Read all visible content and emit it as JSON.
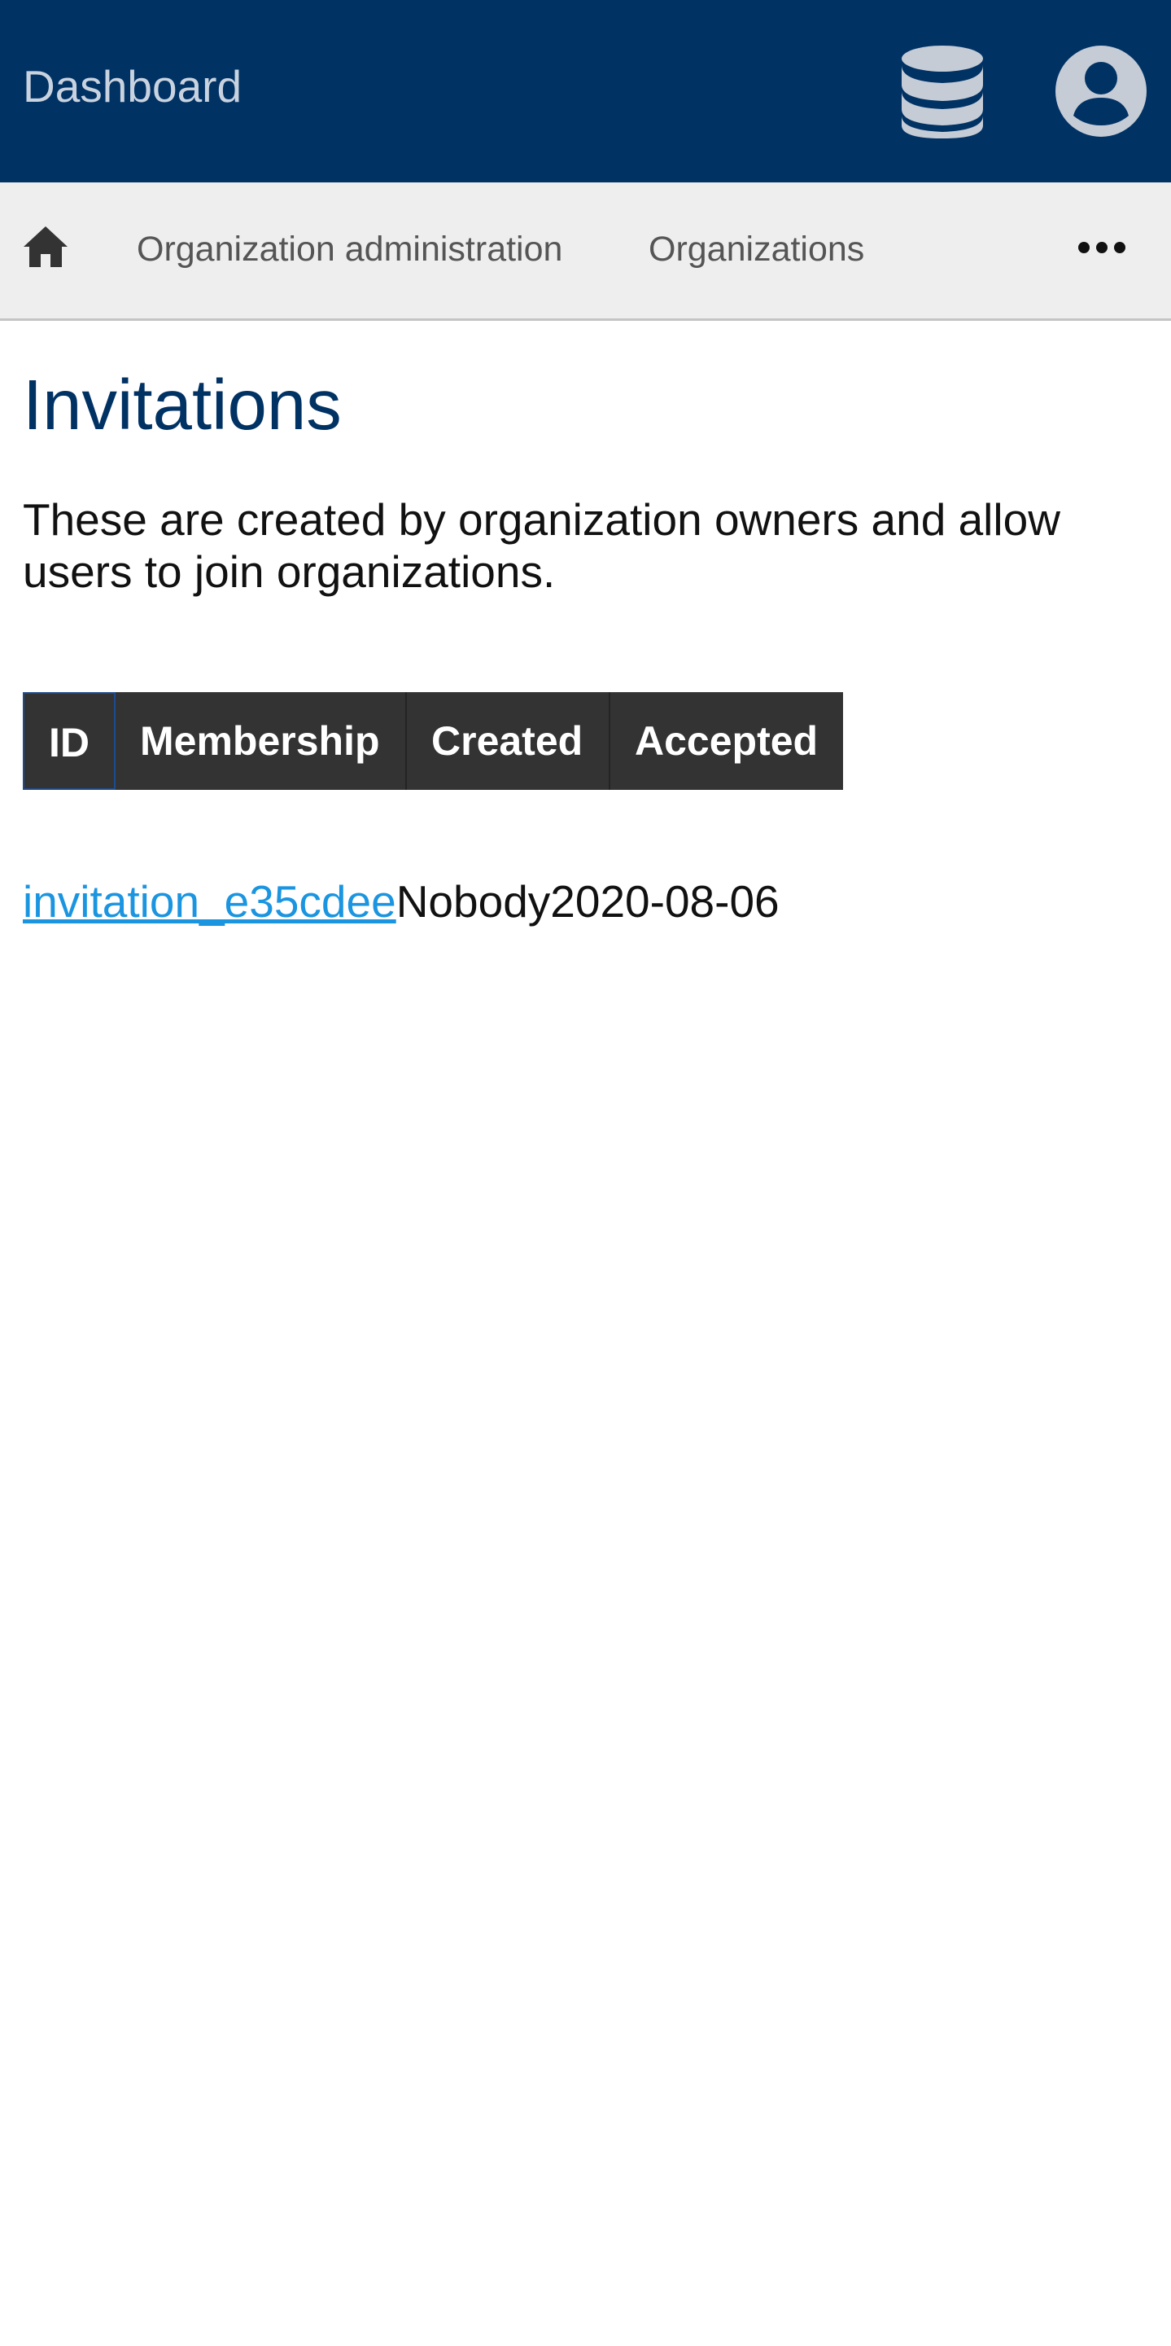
{
  "header": {
    "brand": "Dashboard",
    "background_color": "#013264",
    "icons": [
      "database-icon",
      "user-circle-icon"
    ]
  },
  "breadcrumb": {
    "home_icon": "home-icon",
    "items": [
      {
        "label": "Organization administration"
      },
      {
        "label": "Organizations"
      }
    ],
    "more_icon": "ellipsis-icon"
  },
  "page": {
    "title": "Invitations",
    "intro": "These are created by organization owners and allow users to join organizations."
  },
  "table": {
    "columns": [
      "ID",
      "Membership",
      "Created",
      "Accepted"
    ],
    "header_color": "#333333",
    "rows": [
      {
        "id": "invitation_e35cdee",
        "membership": "Nobody",
        "created": "2020-08-06",
        "accepted": ""
      }
    ]
  },
  "colors": {
    "link": "#1b95e0",
    "title": "#013264",
    "nav_background": "#eeeeee"
  }
}
